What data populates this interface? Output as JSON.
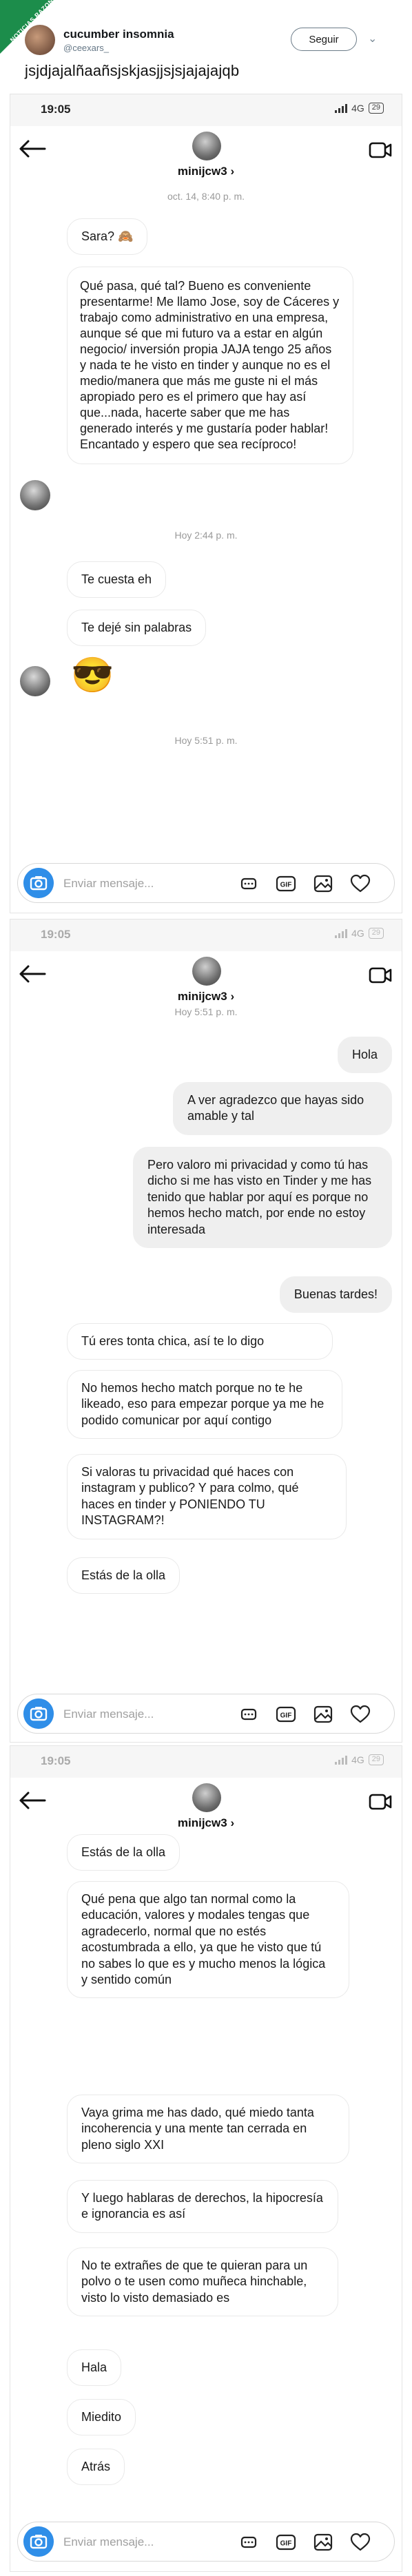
{
  "tweet": {
    "corner_badge": "NOTICIAS RAZONES",
    "display_name": "cucumber insomnia",
    "handle": "@ceexars_",
    "follow_label": "Seguir",
    "text": "jsjdjajalñaañsjskjasjjsjsjajajajqb"
  },
  "screens": [
    {
      "status_time": "19:05",
      "network": "4G",
      "battery": "29",
      "username": "minijcw3",
      "username_chevron": "›",
      "messages": [
        {
          "type": "ts",
          "text": "oct. 14, 8:40 p. m."
        },
        {
          "type": "them",
          "text": "Sara? 🙈"
        },
        {
          "type": "them",
          "text": "Qué pasa, qué tal? Bueno es conveniente presentarme! Me llamo Jose, soy de Cáceres y trabajo como administrativo en una empresa, aunque sé que mi futuro va a estar en algún negocio/ inversión propia JAJA tengo 25 años y nada te he visto en tinder y aunque no es el medio/manera que más me guste ni el más apropiado pero es el primero que hay así que...nada, hacerte saber que me has generado interés y me gustaría poder hablar! Encantado y espero que sea recíproco!"
        },
        {
          "type": "ts",
          "text": "Hoy 2:44 p. m."
        },
        {
          "type": "them",
          "text": "Te cuesta eh"
        },
        {
          "type": "them",
          "text": "Te dejé sin palabras"
        },
        {
          "type": "emoji",
          "text": "😎"
        },
        {
          "type": "ts",
          "text": "Hoy 5:51 p. m."
        }
      ],
      "input_placeholder": "Enviar mensaje..."
    },
    {
      "status_time": "19:05",
      "network": "4G",
      "battery": "29",
      "username": "minijcw3",
      "username_chevron": "›",
      "messages": [
        {
          "type": "ts",
          "text": "Hoy 5:51 p. m."
        },
        {
          "type": "mine",
          "text": "Hola"
        },
        {
          "type": "mine",
          "text": "A ver agradezco que hayas sido amable y tal"
        },
        {
          "type": "mine",
          "text": "Pero valoro mi privacidad y como tú has dicho si me has visto en Tinder y me has tenido que hablar por aquí es porque no hemos hecho match, por ende no estoy interesada"
        },
        {
          "type": "mine",
          "text": "Buenas tardes!"
        },
        {
          "type": "them",
          "text": "Tú eres tonta chica, así te lo digo"
        },
        {
          "type": "them",
          "text": "No hemos hecho match porque no te he likeado, eso para empezar porque ya me he podido comunicar por aquí contigo"
        },
        {
          "type": "them",
          "text": "Si valoras tu privacidad qué haces con instagram y publico? Y para colmo, qué haces en tinder y PONIENDO TU INSTAGRAM?!"
        },
        {
          "type": "them",
          "text": "Estás de la olla"
        }
      ],
      "input_placeholder": "Enviar mensaje..."
    },
    {
      "status_time": "19:05",
      "network": "4G",
      "battery": "29",
      "username": "minijcw3",
      "username_chevron": "›",
      "messages": [
        {
          "type": "them",
          "text": "Estás de la olla"
        },
        {
          "type": "them",
          "text": "Qué pena que algo tan normal como la educación, valores y modales tengas que agradecerlo, normal que no estés acostumbrada a ello, ya que he visto que tú no sabes lo que es y mucho menos la lógica y sentido común"
        },
        {
          "type": "them",
          "text": "Vaya grima me has dado, qué miedo tanta incoherencia y una mente tan cerrada en pleno siglo XXI"
        },
        {
          "type": "them",
          "text": "Y luego hablaras de derechos, la hipocresía e ignorancia es así"
        },
        {
          "type": "them",
          "text": "No te extrañes de que te quieran para un polvo o te usen como muñeca hinchable, visto lo visto demasiado es"
        },
        {
          "type": "them",
          "text": "Hala"
        },
        {
          "type": "them",
          "text": "Miedito"
        },
        {
          "type": "them",
          "text": "Atrás"
        }
      ],
      "input_placeholder": "Enviar mensaje..."
    }
  ],
  "icons": {
    "camera": "camera-icon",
    "microphone": "microphone-icon",
    "gif": "GIF",
    "gallery": "image-icon",
    "like": "heart-icon",
    "back": "arrow-left-icon",
    "video": "video-camera-icon"
  },
  "colors": {
    "accent": "#2f8ee8",
    "my_bubble": "#efefef",
    "their_bubble_border": "#e9e9e9",
    "badge": "#1c8d4b"
  }
}
